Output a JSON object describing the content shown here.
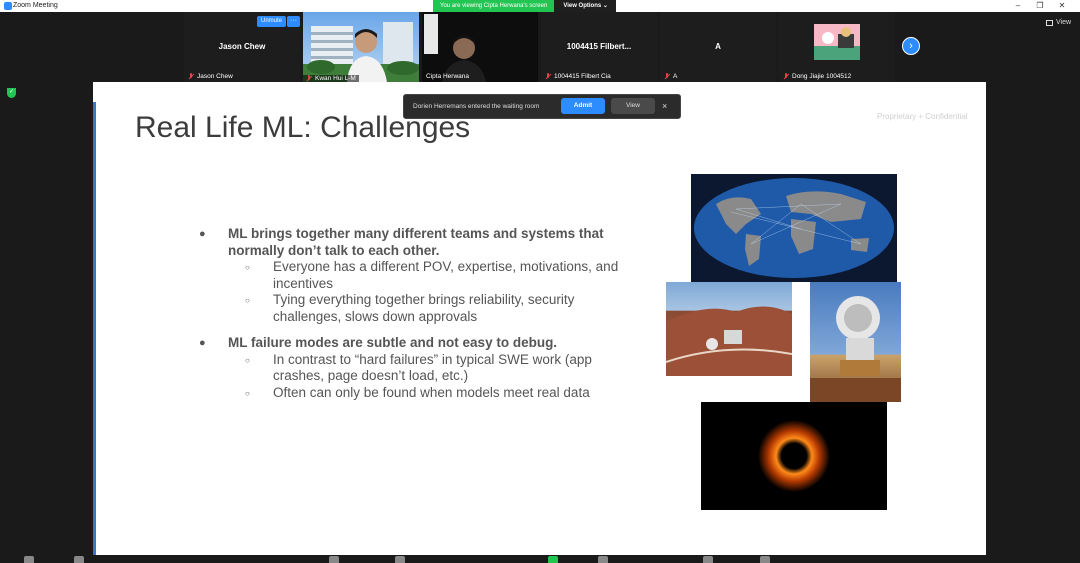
{
  "window": {
    "title": "Zoom Meeting"
  },
  "share_banner": {
    "text": "You are viewing Cipta Herwana's screen",
    "options_label": "View Options ⌄"
  },
  "view_button": {
    "label": "View"
  },
  "participants": [
    {
      "name": "Jason Chew",
      "label": "Jason Chew",
      "video": false
    },
    {
      "name": "",
      "label": "Kwan Hui L-M",
      "video": true
    },
    {
      "name": "",
      "label": "Cipta Herwana",
      "video": true,
      "active_speaker": true
    },
    {
      "name": "1004415  Filbert...",
      "label": "1004415 Filbert Cia",
      "video": false
    },
    {
      "name": "A",
      "label": "A",
      "video": false
    },
    {
      "name": "",
      "label": "Dong Jiajie 1004512",
      "video": false,
      "avatar": true
    }
  ],
  "tile_controls": {
    "unmute_label": "Unmute",
    "more_label": "···"
  },
  "toast": {
    "message": "Dorien Herremans entered the waiting room",
    "admit_label": "Admit",
    "view_label": "View",
    "close_label": "×"
  },
  "slide": {
    "title": "Real Life ML: Challenges",
    "watermark": "Proprietary + Confidential",
    "bullets": [
      {
        "text": "ML brings together many different teams and systems that normally don’t talk to each other.",
        "sub": [
          "Everyone has a different POV, expertise, motivations, and incentives",
          "Tying everything together brings reliability, security challenges, slows down approvals"
        ]
      },
      {
        "text": "ML failure modes are subtle and not easy to debug.",
        "sub": [
          "In contrast to “hard failures” in typical SWE work (app crashes, page doesn’t load, etc.)",
          "Often can only be found when models meet real data"
        ]
      }
    ]
  },
  "colors": {
    "accent": "#2D8CFF",
    "share_green": "#23c552",
    "slide_edge": "#3f74c9"
  }
}
